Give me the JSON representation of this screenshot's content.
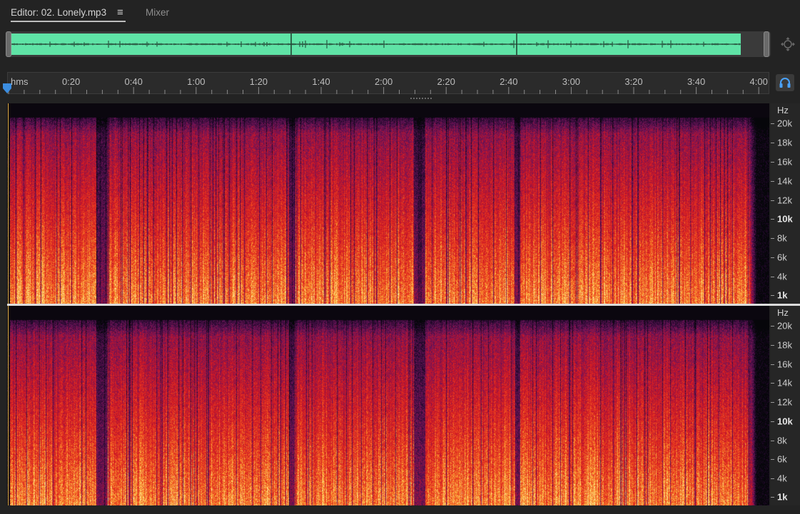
{
  "tabs": {
    "editor_label": "Editor: 02. Lonely.mp3",
    "menu_glyph": "≡",
    "mixer_label": "Mixer"
  },
  "overview": {
    "waveform_color": "#5fe3a6",
    "zoom_icon": "zoom-navigator-icon"
  },
  "ruler": {
    "unit_label": "hms",
    "time_labels": [
      "0:20",
      "0:40",
      "1:00",
      "1:20",
      "1:40",
      "2:00",
      "2:20",
      "2:40",
      "3:00",
      "3:20",
      "3:40",
      "4:00"
    ],
    "monitor_icon": "headphones-icon"
  },
  "frequency_scale": {
    "unit": "Hz",
    "labels": [
      "20k",
      "18k",
      "16k",
      "14k",
      "12k",
      "10k",
      "8k",
      "6k",
      "4k",
      "1k"
    ]
  },
  "spectrogram": {
    "channels": 2,
    "colors": {
      "low": "#1a0a20",
      "mid": "#c01030",
      "high": "#ffd070"
    },
    "playhead_color": "#3b8de0"
  }
}
